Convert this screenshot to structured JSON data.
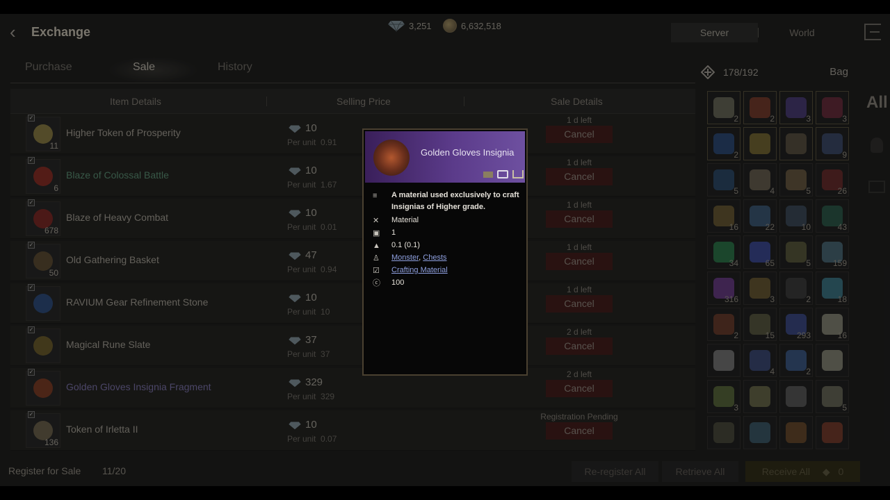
{
  "header": {
    "title": "Exchange",
    "gems": "3,251",
    "gold": "6,632,518",
    "scope": [
      "Server",
      "World"
    ]
  },
  "tabs": [
    "Purchase",
    "Sale",
    "History"
  ],
  "table": {
    "headers": [
      "Item Details",
      "Selling Price",
      "Sale Details"
    ],
    "per_unit_label": "Per unit",
    "cancel_label": "Cancel",
    "rows": [
      {
        "name": "Higher Token of Prosperity",
        "qty": "11",
        "price": "10",
        "unit": "0.91",
        "status": "1 d left",
        "tone": "normal",
        "color": "#8a7a40"
      },
      {
        "name": "Blaze of Colossal Battle",
        "qty": "6",
        "price": "10",
        "unit": "1.67",
        "status": "1 d left",
        "tone": "green",
        "color": "#8a2a22"
      },
      {
        "name": "Blaze of Heavy Combat",
        "qty": "678",
        "price": "10",
        "unit": "0.01",
        "status": "1 d left",
        "tone": "normal",
        "color": "#7a2420"
      },
      {
        "name": "Old Gathering Basket",
        "qty": "50",
        "price": "47",
        "unit": "0.94",
        "status": "1 d left",
        "tone": "normal",
        "color": "#5a4a30"
      },
      {
        "name": "RAVIUM Gear Refinement Stone",
        "qty": "",
        "price": "10",
        "unit": "10",
        "status": "1 d left",
        "tone": "normal",
        "color": "#2a4a7a"
      },
      {
        "name": "Magical Rune Slate",
        "qty": "",
        "price": "37",
        "unit": "37",
        "status": "2 d left",
        "tone": "normal",
        "color": "#6a5a28"
      },
      {
        "name": "Golden Gloves Insignia Fragment",
        "qty": "",
        "price": "329",
        "unit": "329",
        "status": "2 d left",
        "tone": "purple",
        "color": "#7a3a22"
      },
      {
        "name": "Token of Irletta II",
        "qty": "136",
        "price": "10",
        "unit": "0.07",
        "status": "Registration Pending",
        "tone": "normal",
        "color": "#6a6048"
      }
    ]
  },
  "footer": {
    "register_label": "Register for Sale",
    "register_count": "11/20",
    "reregister": "Re-register All",
    "retrieve": "Retrieve All",
    "receive": "Receive All",
    "receive_count": "0"
  },
  "bag": {
    "capacity": "178/192",
    "label": "Bag",
    "filter_all": "All",
    "slots": [
      {
        "n": "2",
        "c": "#6a6a5a"
      },
      {
        "n": "2",
        "c": "#7a3a2a"
      },
      {
        "n": "3",
        "c": "#4a3a7a"
      },
      {
        "n": "3",
        "c": "#6a2a3a"
      },
      {
        "n": "2",
        "c": "#2a4a7a"
      },
      {
        "n": "",
        "c": "#7a6a30"
      },
      {
        "n": "",
        "c": "#5a5040"
      },
      {
        "n": "9",
        "c": "#3a4a6a"
      },
      {
        "n": "5",
        "c": "#2a4a6a"
      },
      {
        "n": "4",
        "c": "#6a6050"
      },
      {
        "n": "5",
        "c": "#6a5a40"
      },
      {
        "n": "26",
        "c": "#6a2a2a"
      },
      {
        "n": "16",
        "c": "#6a5a30"
      },
      {
        "n": "22",
        "c": "#3a5a7a"
      },
      {
        "n": "10",
        "c": "#3a4a5a"
      },
      {
        "n": "43",
        "c": "#2a5a4a"
      },
      {
        "n": "34",
        "c": "#2a7a4a"
      },
      {
        "n": "65",
        "c": "#3a4a9a"
      },
      {
        "n": "5",
        "c": "#5a5a3a"
      },
      {
        "n": "159",
        "c": "#4a6a7a"
      },
      {
        "n": "316",
        "c": "#6a3a8a"
      },
      {
        "n": "3",
        "c": "#6a5a30"
      },
      {
        "n": "2",
        "c": "#3a3a3a"
      },
      {
        "n": "18",
        "c": "#3a7a8a"
      },
      {
        "n": "2",
        "c": "#6a3a2a"
      },
      {
        "n": "15",
        "c": "#5a5a40"
      },
      {
        "n": "293",
        "c": "#3a4a8a"
      },
      {
        "n": "16",
        "c": "#8a8a7a"
      },
      {
        "n": "",
        "c": "#7a7a7a"
      },
      {
        "n": "4",
        "c": "#3a4a7a"
      },
      {
        "n": "2",
        "c": "#3a5a8a"
      },
      {
        "n": "",
        "c": "#8a8a7a"
      },
      {
        "n": "3",
        "c": "#5a6a3a"
      },
      {
        "n": "",
        "c": "#6a6a4a"
      },
      {
        "n": "",
        "c": "#5a5a5a"
      },
      {
        "n": "5",
        "c": "#6a6a5a"
      },
      {
        "n": "",
        "c": "#4a4a3a"
      },
      {
        "n": "",
        "c": "#3a5a6a"
      },
      {
        "n": "",
        "c": "#6a4a2a"
      },
      {
        "n": "",
        "c": "#7a3a2a"
      }
    ]
  },
  "tooltip": {
    "title": "Golden Gloves Insignia",
    "description": "A material used exclusively to craft Insignias of Higher grade.",
    "type": "Material",
    "stack": "1",
    "weight": "0.1 (0.1)",
    "source_1": "Monster",
    "source_sep": ",",
    "source_2": "Chests",
    "category": "Crafting Material",
    "price": "100"
  }
}
